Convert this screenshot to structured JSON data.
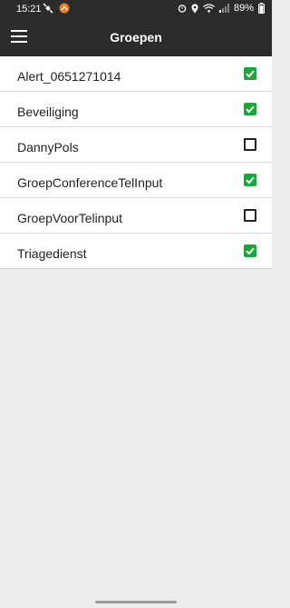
{
  "status_bar": {
    "time": "15:21",
    "battery": "89%",
    "left_icons": [
      "satellite-icon",
      "app-notification-icon"
    ],
    "right_icons": [
      "alarm-icon",
      "location-icon",
      "wifi-icon",
      "signal-icon",
      "battery-icon"
    ]
  },
  "app_bar": {
    "title": "Groepen",
    "menu_icon": "hamburger-menu-icon",
    "background": "#2b2b2b"
  },
  "groups": [
    {
      "label": "Alert_0651271014",
      "checked": true
    },
    {
      "label": "Beveiliging",
      "checked": true
    },
    {
      "label": "DannyPols",
      "checked": false
    },
    {
      "label": "GroepConferenceTelInput",
      "checked": true
    },
    {
      "label": "GroepVoorTelinput",
      "checked": false
    },
    {
      "label": "Triagedienst",
      "checked": true
    }
  ],
  "colors": {
    "checked": "#17a837",
    "page_background": "#ececec"
  }
}
